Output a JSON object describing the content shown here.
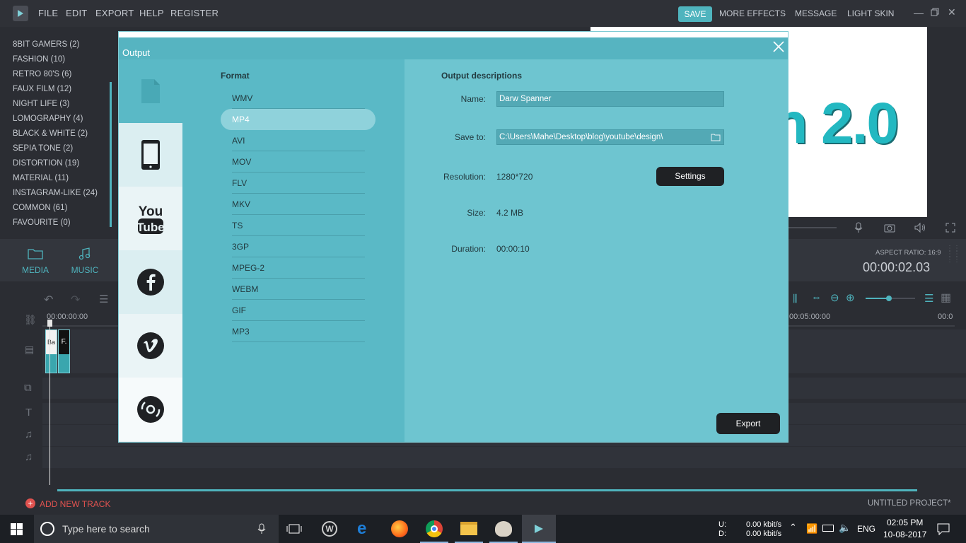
{
  "menubar": {
    "items": [
      "FILE",
      "EDIT",
      "EXPORT",
      "HELP",
      "REGISTER"
    ],
    "save_label": "SAVE",
    "right_items": [
      "MORE EFFECTS",
      "MESSAGE",
      "LIGHT SKIN"
    ]
  },
  "filters": [
    "8BIT GAMERS (2)",
    "FASHION (10)",
    "RETRO 80'S (6)",
    "FAUX FILM (12)",
    "NIGHT LIFE (3)",
    "LOMOGRAPHY (4)",
    "BLACK & WHITE (2)",
    "SEPIA TONE (2)",
    "DISTORTION (19)",
    "MATERIAL (11)",
    "INSTAGRAM-LIKE (24)",
    "COMMON (61)",
    "FAVOURITE (0)"
  ],
  "preview": {
    "text": "n 2.0"
  },
  "tabs": {
    "media": "MEDIA",
    "music": "MUSIC"
  },
  "player": {
    "aspect_ratio": "ASPECT RATIO: 16:9",
    "timecode": "00:00:02.03"
  },
  "timeline": {
    "start_time": "00:00:00:00",
    "mid_time": "00:05:00:00",
    "end_time": "00:0",
    "clip1": "Ba",
    "clip2": "F."
  },
  "footer": {
    "add_track": "ADD NEW TRACK",
    "project": "UNTITLED PROJECT*"
  },
  "dialog": {
    "title": "Output",
    "format_heading": "Format",
    "formats": [
      "WMV",
      "MP4",
      "AVI",
      "MOV",
      "FLV",
      "MKV",
      "TS",
      "3GP",
      "MPEG-2",
      "WEBM",
      "GIF",
      "MP3"
    ],
    "selected_format": "MP4",
    "desc_heading": "Output descriptions",
    "name_label": "Name:",
    "name_value": "Darw Spanner",
    "save_label": "Save to:",
    "save_value": "C:\\Users\\Mahe\\Desktop\\blog\\youtube\\design\\",
    "resolution_label": "Resolution:",
    "resolution_value": "1280*720",
    "settings_label": "Settings",
    "size_label": "Size:",
    "size_value": "4.2 MB",
    "duration_label": "Duration:",
    "duration_value": "00:00:10",
    "export_label": "Export"
  },
  "taskbar": {
    "search_placeholder": "Type here to search",
    "net_up_label": "U:",
    "net_down_label": "D:",
    "net_up": "0.00 kbit/s",
    "net_down": "0.00 kbit/s",
    "lang": "ENG",
    "time": "02:05 PM",
    "date": "10-08-2017"
  },
  "colors": {
    "accent": "#4fb4be",
    "dialog_bg": "#5ab9c6",
    "desc_bg": "#6ec5d0"
  }
}
